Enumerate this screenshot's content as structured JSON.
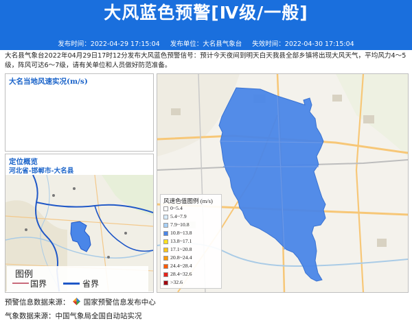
{
  "header": {
    "title": "大风蓝色预警[Ⅳ级/一般]",
    "publish_time": "发布时间：2022-04-29 17:15:04",
    "publisher": "发布单位：大名县气象台",
    "expire_time": "失效时间：2022-04-30 17:15:04"
  },
  "bulletin": {
    "text": "大名县气象台2022年04月29日17时12分发布大风蓝色预警信号：预计今天夜间到明天白天我县全部乡镇将出现大风天气，平均风力4～5级，阵风可达6～7级，请有关单位和人员做好防范准备。"
  },
  "wind_panel": {
    "title": "大名当地风速实况(m/s)"
  },
  "location_panel": {
    "title": "定位概览",
    "subtitle": "河北省-邯郸市-大名县"
  },
  "map_legend": {
    "title": "图例",
    "items": [
      {
        "label": "国界",
        "color": "#c86a7a"
      },
      {
        "label": "省界",
        "color": "#1f57c7"
      }
    ]
  },
  "wind_legend": {
    "title": "风速色值图例 (m/s)",
    "items": [
      {
        "label": "0~5.4",
        "color": "#ffffff"
      },
      {
        "label": "5.4~7.9",
        "color": "#d9ecff"
      },
      {
        "label": "7.9~10.8",
        "color": "#a9d1f7"
      },
      {
        "label": "10.8~13.8",
        "color": "#4a86e8"
      },
      {
        "label": "13.8~17.1",
        "color": "#ffe21f"
      },
      {
        "label": "17.1~20.8",
        "color": "#ffc61a"
      },
      {
        "label": "20.8~24.4",
        "color": "#ff9a00"
      },
      {
        "label": "24.4~28.4",
        "color": "#ff5a00"
      },
      {
        "label": "28.4~32.6",
        "color": "#e8221a"
      },
      {
        "label": ">32.6",
        "color": "#a3000f"
      }
    ]
  },
  "footer": {
    "source_label": "预警信息数据来源：",
    "source_name": "国家预警信息发布中心",
    "weather_source": "气象数据来源：中国气象局全国自动站实况"
  },
  "colors": {
    "header_blue": "#1a6fdd",
    "warning_area": "#4a86e8"
  }
}
